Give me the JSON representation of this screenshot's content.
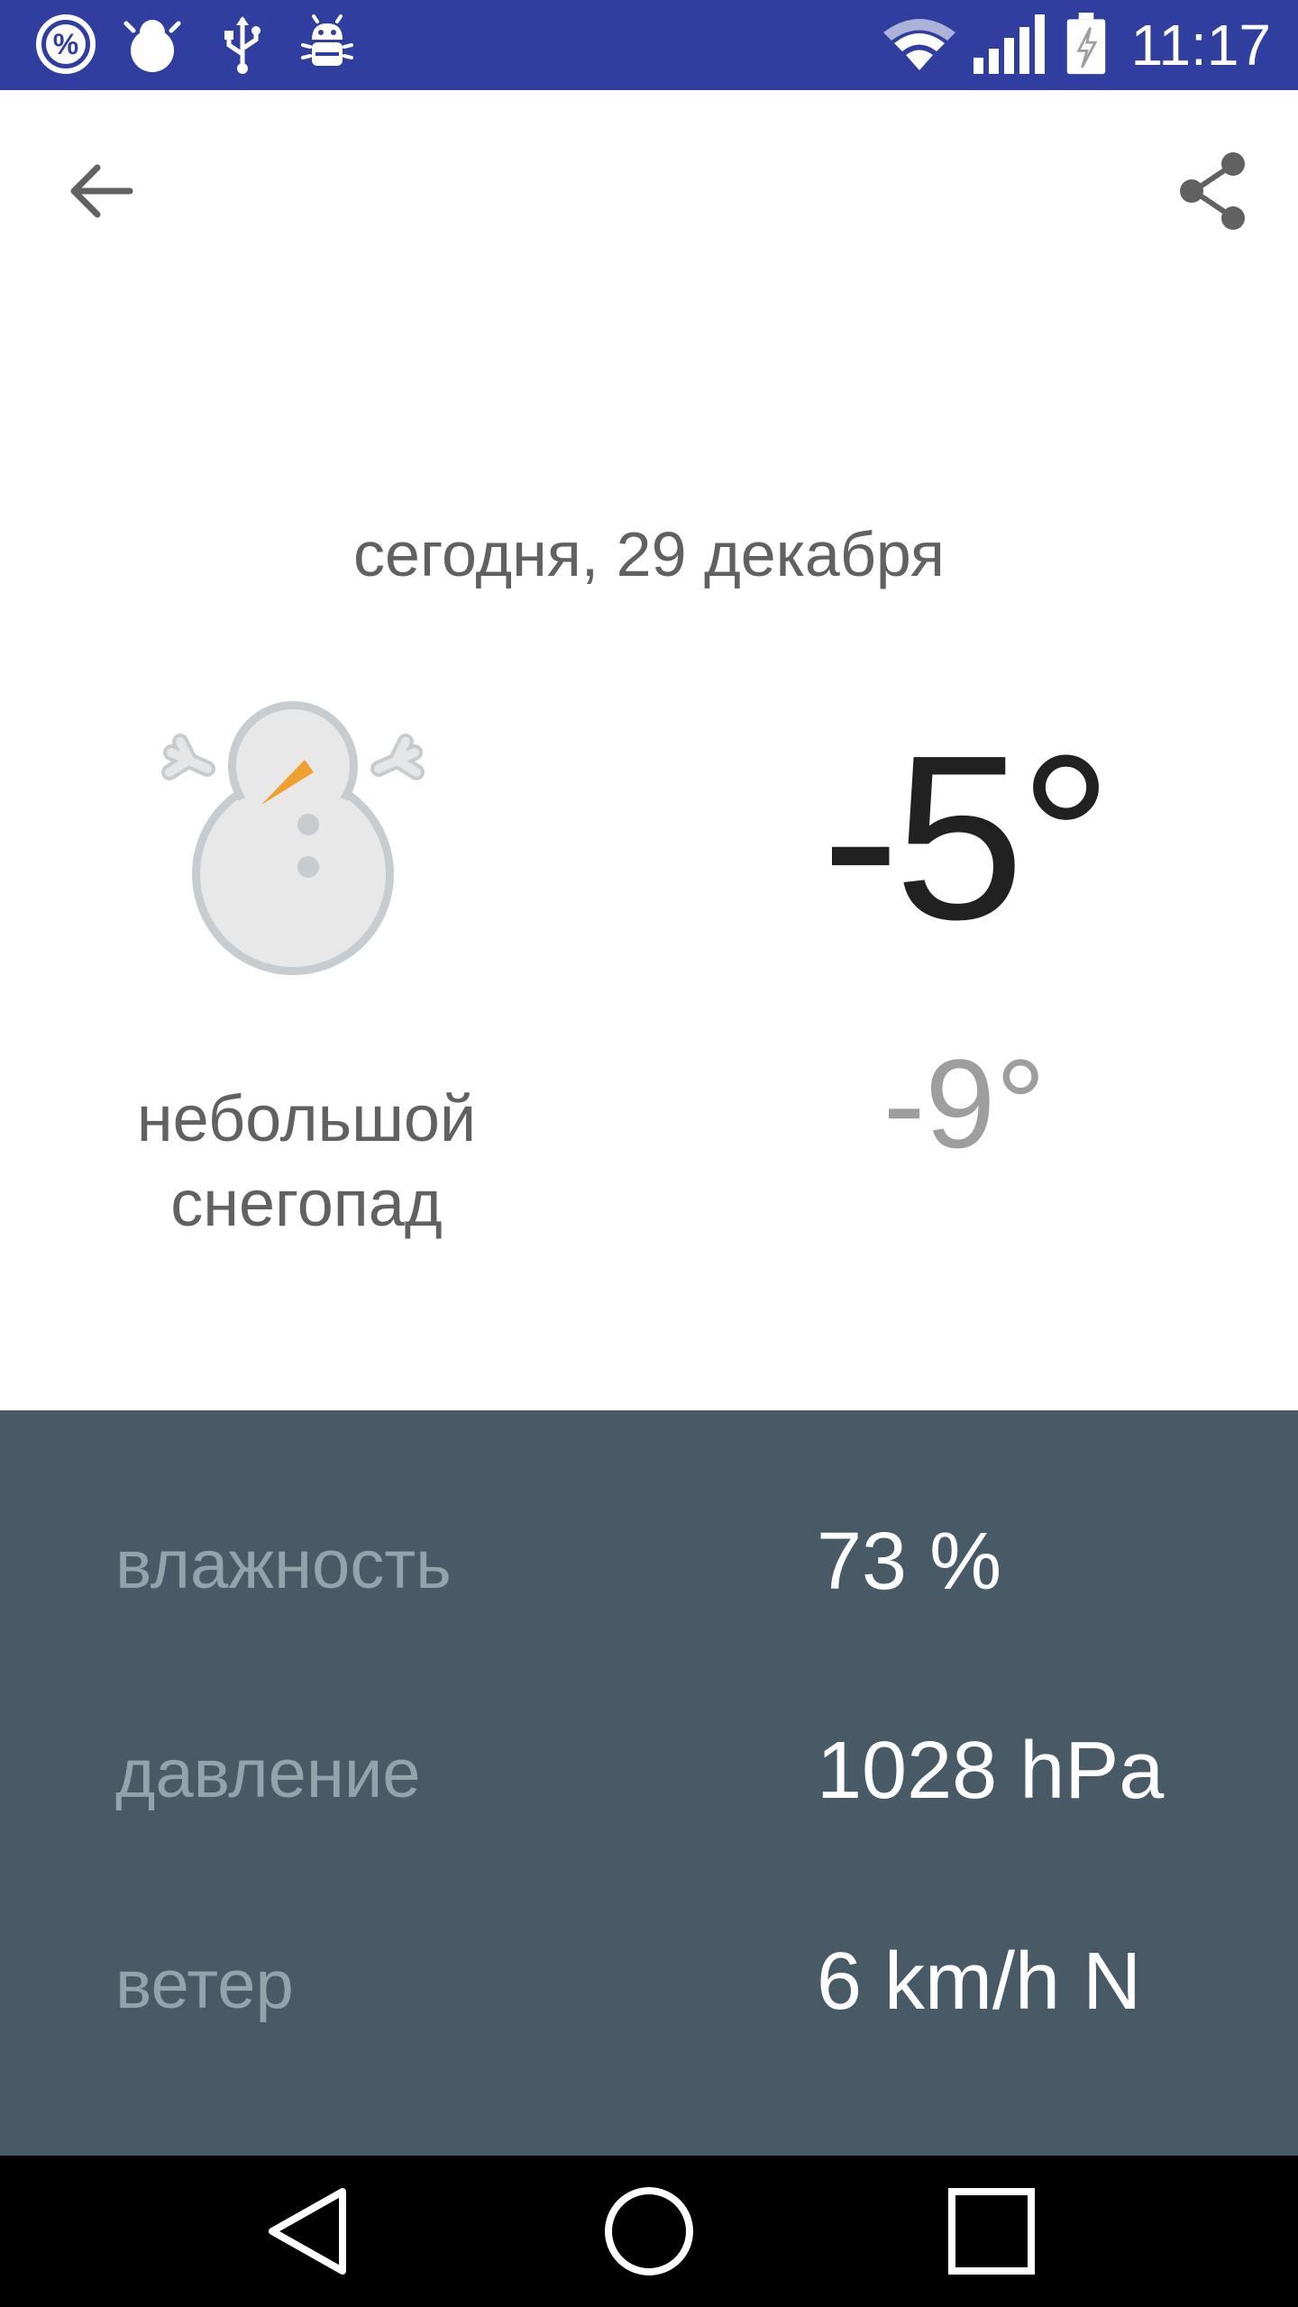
{
  "status_bar": {
    "time": "11:17",
    "color": "#303f9f",
    "left_icons": [
      "percent-icon",
      "snowman-notification-icon",
      "usb-icon",
      "android-debug-icon"
    ],
    "right_icons": [
      "wifi-icon",
      "signal-icon",
      "battery-charging-icon"
    ]
  },
  "toolbar": {
    "back_icon": "arrow-left-icon",
    "share_icon": "share-icon"
  },
  "forecast": {
    "date": "сегодня, 29 декабря",
    "condition_line1": "небольшой",
    "condition_line2": "снегопад",
    "icon": "snowman-icon",
    "temp_high": "-5°",
    "temp_low": "-9°"
  },
  "details": {
    "background": "#475a66",
    "humidity_label": "влажность",
    "humidity_value": "73 %",
    "pressure_label": "давление",
    "pressure_value": "1028 hPa",
    "wind_label": "ветер",
    "wind_value": "6 km/h N"
  },
  "nav_bar": {
    "back": "triangle-back-icon",
    "home": "circle-home-icon",
    "recents": "square-recents-icon"
  }
}
